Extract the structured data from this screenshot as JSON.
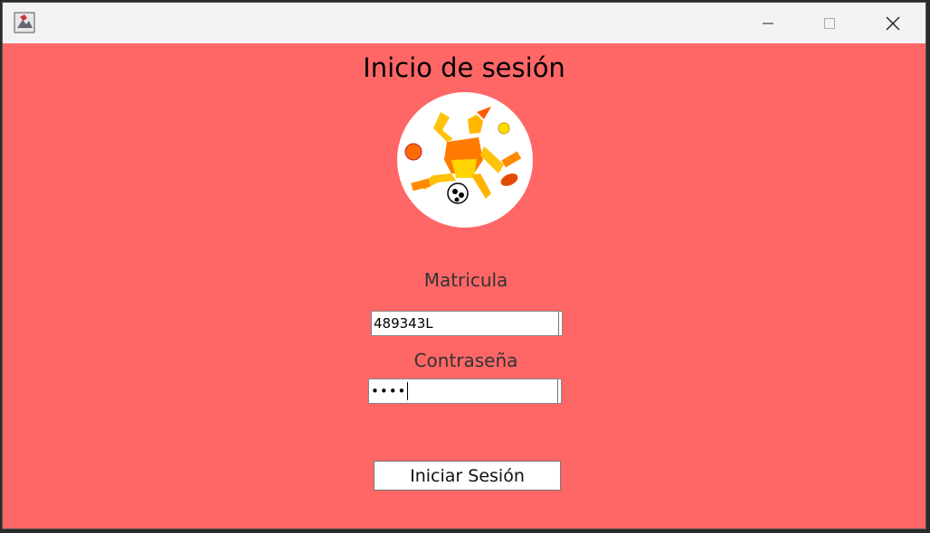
{
  "window": {
    "icons": {
      "app": "java-app-icon",
      "minimize": "minimize-icon",
      "maximize": "maximize-icon",
      "close": "close-icon"
    }
  },
  "login": {
    "title": "Inicio de sesión",
    "logo": "sports-mascot-logo",
    "matricula_label": "Matricula",
    "matricula_value": "489343L",
    "password_label": "Contraseña",
    "password_value": "••••",
    "submit_label": "Iniciar Sesión"
  },
  "colors": {
    "background": "#ff6767",
    "titlebar": "#f3f3f3"
  }
}
